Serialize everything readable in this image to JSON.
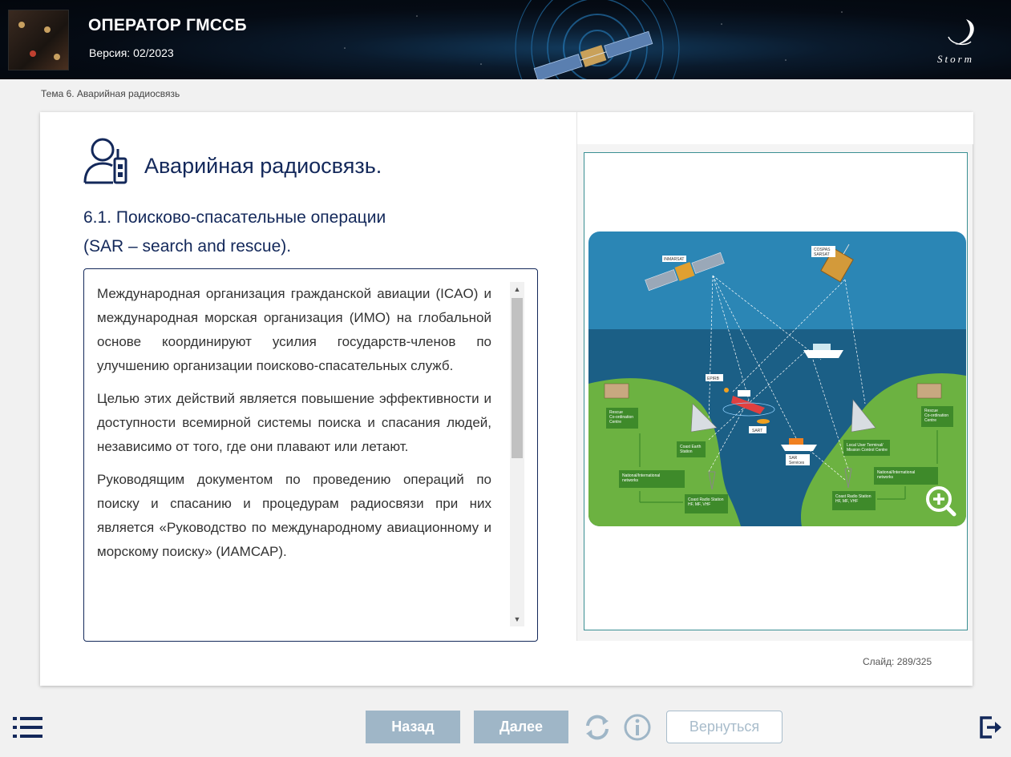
{
  "header": {
    "app_title": "ОПЕРАТОР ГМССБ",
    "version": "Версия: 02/2023",
    "logo_text": "Storm"
  },
  "breadcrumb": "Тема 6. Аварийная радиосвязь",
  "slide": {
    "title": "Аварийная радиосвязь.",
    "subtitle_line1": "6.1. Поисково-спасательные операции",
    "subtitle_line2": "(SAR – search and rescue).",
    "paragraphs": [
      "Международная организация гражданской авиации (ICAO) и международная морская организация (ИМО) на глобальной основе координируют усилия государств-членов по улучшению организации поисково-спасательных служб.",
      "Целью этих действий является повышение эффективности и доступности всемирной системы поиска и спасания людей, независимо от того, где они плавают или летают.",
      "Руководящим документом по проведению операций по поиску и спасанию и процедурам радиосвязи при них является «Руководство по международному авиационному и морскому поиску» (ИАМСАР)."
    ],
    "slide_label": "Слайд:",
    "slide_number": "289/325"
  },
  "diagram": {
    "labels": {
      "inmarsat": "INMARSAT",
      "cospas": "COSPAS",
      "sarsat": "SARSAT",
      "epirb": "EPIRB",
      "sart": "SART",
      "sar_services_1": "SAR",
      "sar_services_2": "Services",
      "rcc_left_1": "Rescue",
      "rcc_left_2": "Co-ordination",
      "rcc_left_3": "Centre",
      "rcc_right_1": "Rescue",
      "rcc_right_2": "Co-ordination",
      "rcc_right_3": "Centre",
      "ces_1": "Coast Earth",
      "ces_2": "Station",
      "lut_1": "Local User Terminal/",
      "lut_2": "Mission Control Centre",
      "net_left_1": "National/International",
      "net_left_2": "networks",
      "net_right_1": "National/International",
      "net_right_2": "networks",
      "crs_left_1": "Coast Radio Station",
      "crs_left_2": "HF, MF, VHF",
      "crs_right_1": "Coast Radio Station",
      "crs_right_2": "HF, MF, VHF"
    }
  },
  "footer": {
    "back_label": "Назад",
    "next_label": "Далее",
    "return_label": "Вернуться"
  },
  "colors": {
    "accent_navy": "#13285a",
    "button_disabled": "#9fb6c7",
    "frame_teal": "#3a8f93"
  }
}
